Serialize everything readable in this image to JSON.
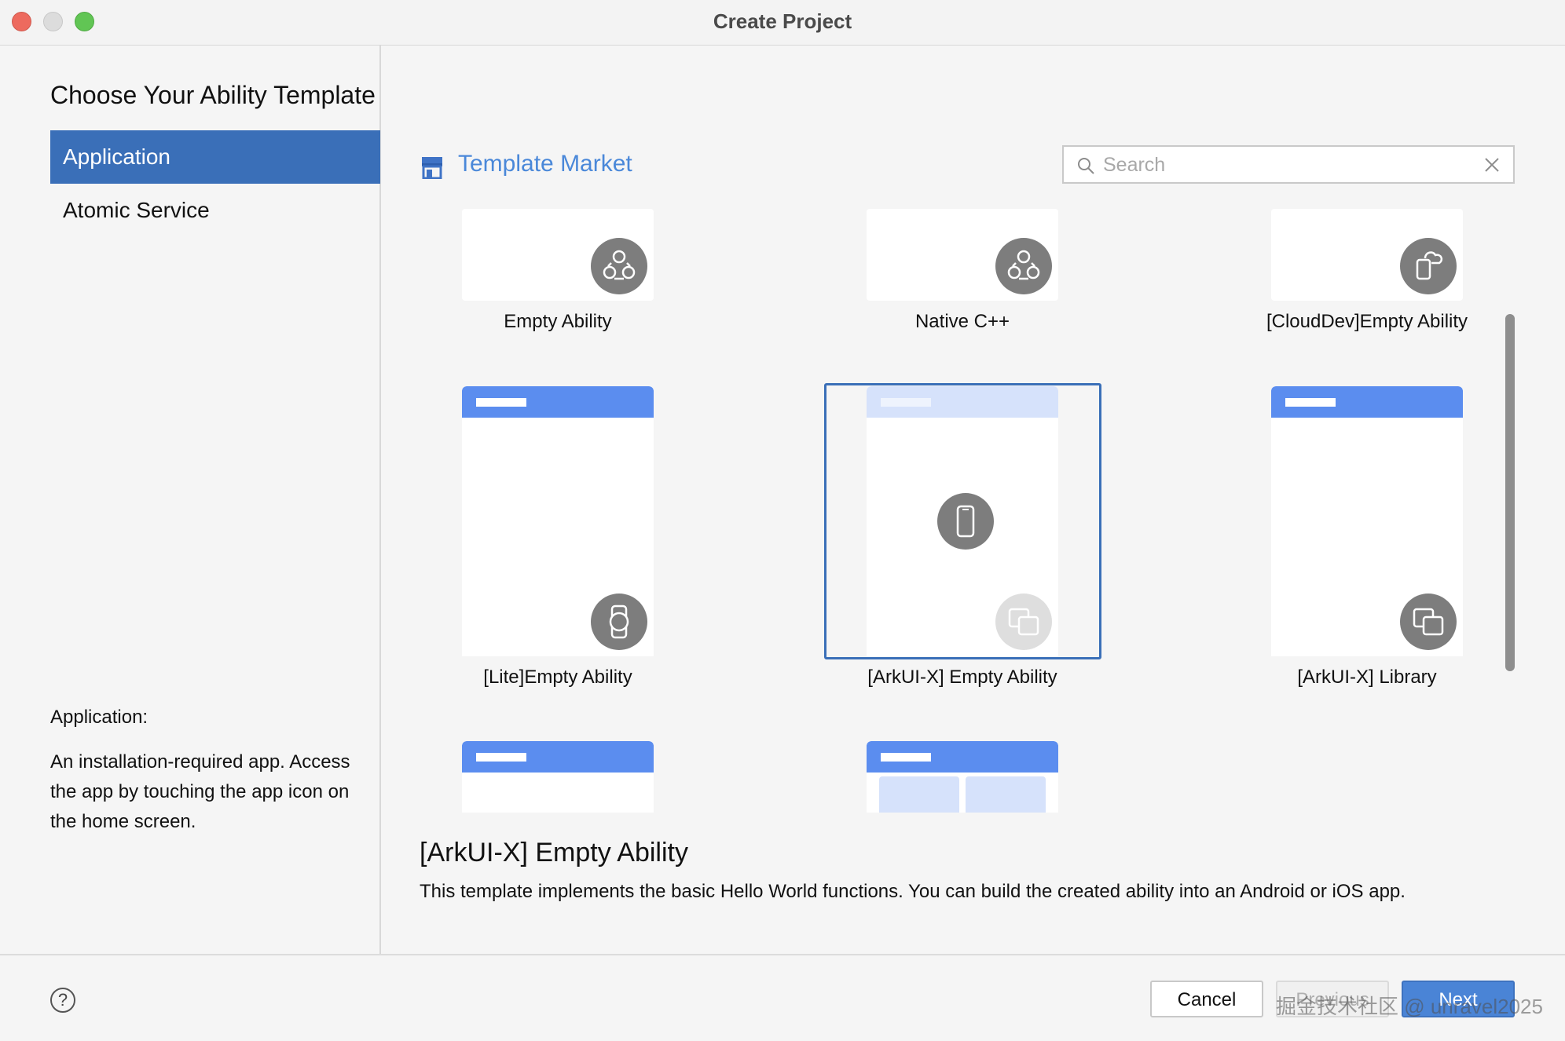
{
  "window": {
    "title": "Create Project"
  },
  "heading": "Choose Your Ability Template",
  "sidebar": {
    "items": [
      {
        "label": "Application",
        "active": true
      },
      {
        "label": "Atomic Service",
        "active": false
      }
    ],
    "description_title": "Application:",
    "description": "An installation-required app. Access the app by touching the app icon on the home screen."
  },
  "market": {
    "title": "Template Market",
    "icon": "store-icon"
  },
  "search": {
    "placeholder": "Search",
    "value": ""
  },
  "templates": [
    {
      "label": "Empty Ability",
      "icon": "nodes-icon"
    },
    {
      "label": "Native C++",
      "icon": "nodes-icon"
    },
    {
      "label": "[CloudDev]Empty Ability",
      "icon": "cloud-device-icon"
    },
    {
      "label": "[Lite]Empty Ability",
      "icon": "watch-icon"
    },
    {
      "label": "[ArkUI-X] Empty Ability",
      "icon": "phone-icon",
      "selected": true
    },
    {
      "label": "[ArkUI-X] Library",
      "icon": "multi-device-icon"
    }
  ],
  "selected": {
    "title": "[ArkUI-X] Empty Ability",
    "description": "This template implements the basic Hello World functions. You can build the created ability into an Android or iOS app."
  },
  "footer": {
    "help": "?",
    "cancel": "Cancel",
    "previous": "Previous",
    "next": "Next",
    "watermark": "掘金技术社区 @ unravel2025"
  },
  "colors": {
    "accent": "#3a6fb8",
    "link": "#4a88d9",
    "thumb_header": "#5b8def"
  }
}
